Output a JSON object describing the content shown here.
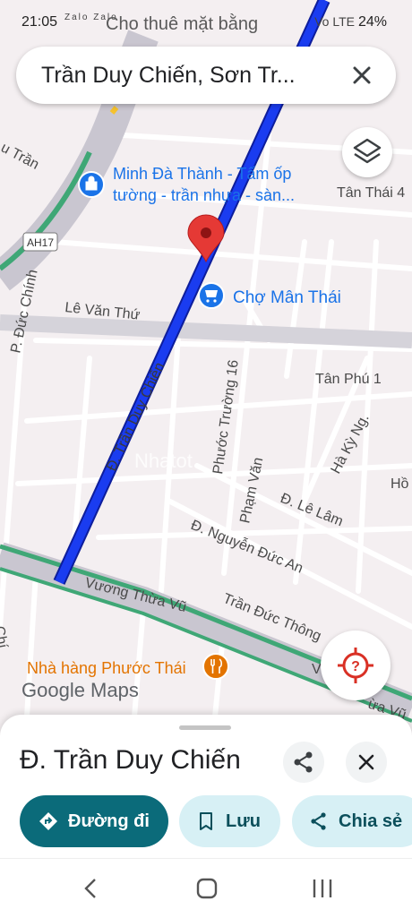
{
  "status_bar": {
    "time": "21:05",
    "notification_icons": "Zalo Zalo",
    "notification_text": "Cho thuê mặt bằng",
    "system_icons": "Vo LTE",
    "battery": "24%"
  },
  "search": {
    "query": "Trần Duy Chiến, Sơn Tr...",
    "close_icon": "close-icon"
  },
  "map": {
    "streets": {
      "tran_duy_chien": "Đ. Trần Duy Chiến",
      "le_van_thu": "Lê Văn Thứ",
      "duc_chinh": "P. Đức Chính",
      "tan_thai_4": "Tân Thái 4",
      "tan_phu_1": "Tân Phú 1",
      "phuoc_truong_16": "Phước Trường 16",
      "ha_ky_ngo": "Hà Kỳ Ng.",
      "pham_van": "Phạm Văn",
      "le_lam": "Đ. Lê Lâm",
      "nguyen_duc_an": "Đ. Nguyễn Đức An",
      "vuong_thua_vu": "Vương Thừa Vũ",
      "tran_duc_thong": "Trần Đức Thông",
      "u_tran": "u Trần",
      "vuong_thua_vu_right": "ừa Vũ",
      "ho_partial": "Hồ",
      "chinh_partial": "Chí",
      "highway": "AH17",
      "edge_v": "V"
    },
    "places": {
      "shop": {
        "line1": "Minh Đà Thành - Tấm ốp",
        "line2": "tường - trần nhựa - sàn..."
      },
      "market": "Chợ Mân Thái",
      "restaurant": "Nhà hàng Phước Thái"
    },
    "watermark": "Nhatot",
    "attribution": "Google Maps",
    "colors": {
      "route": "#1a3cf0",
      "park_road": "#3fa776",
      "pin": "#e53935",
      "shop": "#1a73e8",
      "restaurant": "#e37400"
    }
  },
  "sheet": {
    "title": "Đ. Trần Duy Chiến",
    "actions": {
      "directions": "Đường đi",
      "save": "Lưu",
      "share": "Chia sẻ"
    },
    "accent": "#0b6b7a"
  }
}
